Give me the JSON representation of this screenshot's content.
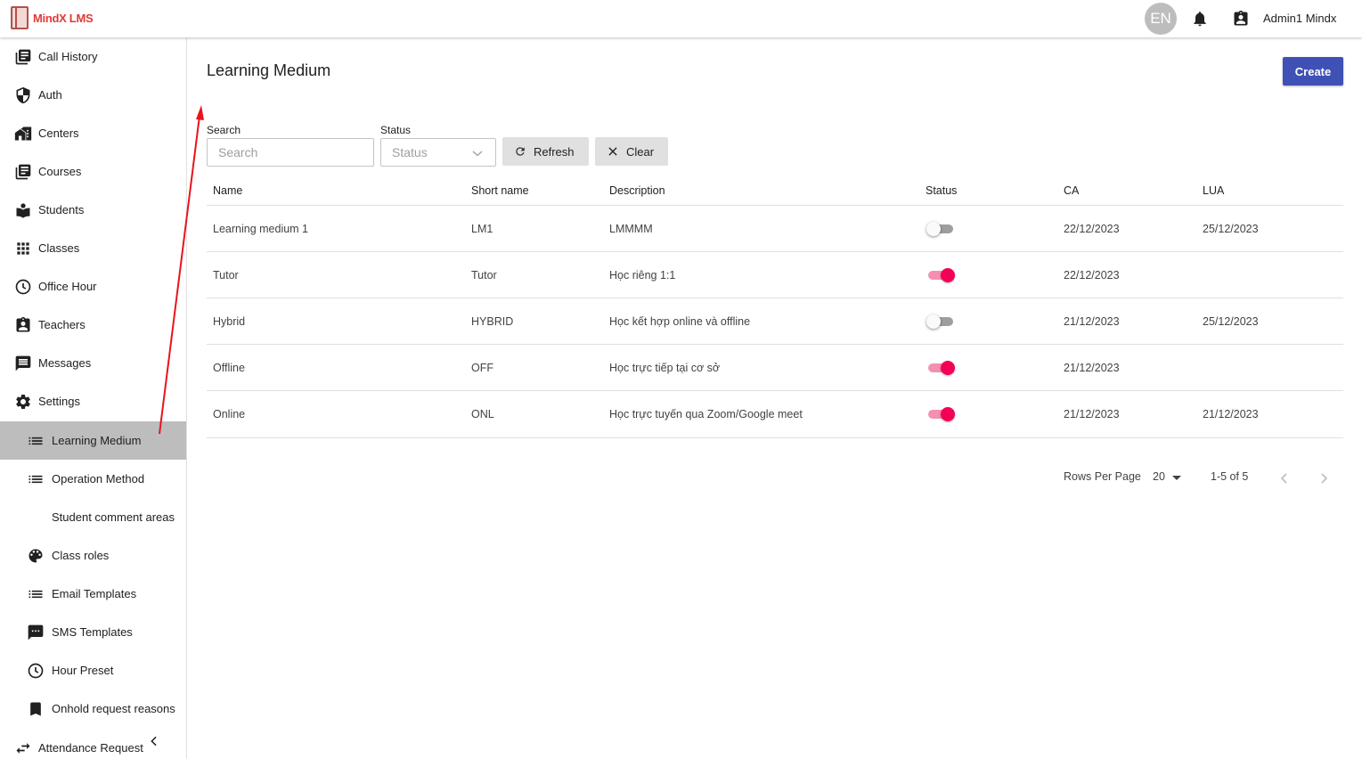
{
  "app": {
    "logo_text": "MindX LMS"
  },
  "header": {
    "lang": "EN",
    "user_name": "Admin1 Mindx"
  },
  "sidebar": {
    "items": [
      {
        "label": "Call History",
        "icon": "call-history-icon"
      },
      {
        "label": "Auth",
        "icon": "shield-icon"
      },
      {
        "label": "Centers",
        "icon": "centers-icon"
      },
      {
        "label": "Courses",
        "icon": "courses-icon"
      },
      {
        "label": "Students",
        "icon": "students-icon"
      },
      {
        "label": "Classes",
        "icon": "grid-icon"
      },
      {
        "label": "Office Hour",
        "icon": "clock-icon"
      },
      {
        "label": "Teachers",
        "icon": "teacher-badge-icon"
      },
      {
        "label": "Messages",
        "icon": "message-icon"
      },
      {
        "label": "Settings",
        "icon": "gear-icon"
      },
      {
        "label": "Learning Medium",
        "icon": "list-icon",
        "active": true
      },
      {
        "label": "Operation Method",
        "icon": "list-icon"
      },
      {
        "label": "Student comment areas",
        "icon": ""
      },
      {
        "label": "Class roles",
        "icon": "palette-icon"
      },
      {
        "label": "Email Templates",
        "icon": "list-icon"
      },
      {
        "label": "SMS Templates",
        "icon": "sms-icon"
      },
      {
        "label": "Hour Preset",
        "icon": "clock-icon"
      },
      {
        "label": "Onhold request reasons",
        "icon": "bookmark-icon"
      },
      {
        "label": "Attendance Request",
        "icon": "swap-icon"
      }
    ]
  },
  "main": {
    "title": "Learning Medium",
    "create_label": "Create",
    "filters": {
      "search_label": "Search",
      "search_placeholder": "Search",
      "status_label": "Status",
      "status_placeholder": "Status",
      "refresh_label": "Refresh",
      "clear_label": "Clear"
    },
    "table": {
      "columns": [
        "Name",
        "Short name",
        "Description",
        "Status",
        "CA",
        "LUA"
      ],
      "rows": [
        {
          "name": "Learning medium 1",
          "short": "LM1",
          "desc": "LMMMM",
          "status_on": false,
          "ca": "22/12/2023",
          "lua": "25/12/2023"
        },
        {
          "name": "Tutor",
          "short": "Tutor",
          "desc": "Học riêng 1:1",
          "status_on": true,
          "ca": "22/12/2023",
          "lua": ""
        },
        {
          "name": "Hybrid",
          "short": "HYBRID",
          "desc": "Học kết hợp online và offline",
          "status_on": false,
          "ca": "21/12/2023",
          "lua": "25/12/2023"
        },
        {
          "name": "Offline",
          "short": "OFF",
          "desc": "Học trực tiếp tại cơ sở",
          "status_on": true,
          "ca": "21/12/2023",
          "lua": ""
        },
        {
          "name": "Online",
          "short": "ONL",
          "desc": "Học trực tuyến qua Zoom/Google meet",
          "status_on": true,
          "ca": "21/12/2023",
          "lua": "21/12/2023"
        }
      ]
    },
    "pagination": {
      "rows_per_page_label": "Rows Per Page",
      "rows_per_page": "20",
      "range": "1-5 of 5"
    }
  },
  "colors": {
    "primary": "#3f51b5",
    "toggle_on": "#f50057",
    "active_nav": "#bdbdbd",
    "annotation": "#e8141a"
  }
}
